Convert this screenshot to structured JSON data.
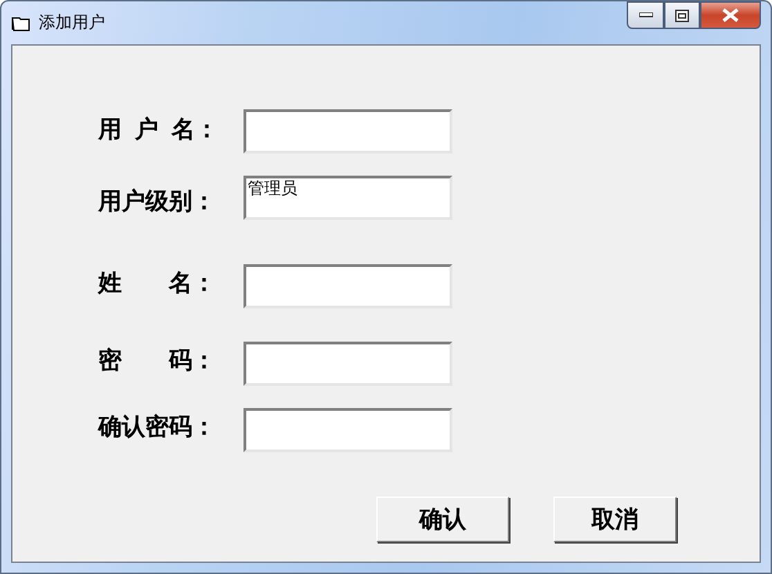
{
  "window": {
    "title": "添加用户"
  },
  "fields": [
    {
      "label": "用  户  名："
    },
    {
      "label": "用户级别：",
      "value": "管理员"
    },
    {
      "label": "姓　　名："
    },
    {
      "label": "密　　码："
    },
    {
      "label": "确认密码："
    }
  ],
  "buttons": [
    "确认",
    "取消"
  ]
}
